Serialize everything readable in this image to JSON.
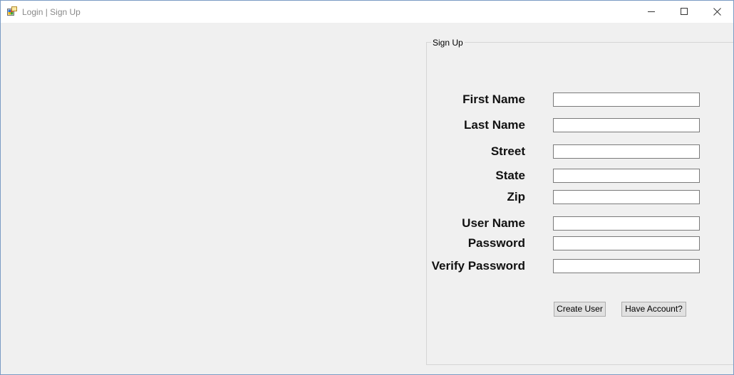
{
  "window": {
    "title": "Login | Sign Up",
    "app_icon": "winforms-app-icon",
    "controls": {
      "minimize_icon": "minimize-icon",
      "maximize_icon": "maximize-icon",
      "close_icon": "close-icon"
    }
  },
  "signup": {
    "group_title": "Sign Up",
    "fields": [
      {
        "label": "First Name",
        "value": "",
        "placeholder": ""
      },
      {
        "label": "Last Name",
        "value": "",
        "placeholder": ""
      },
      {
        "label": "Street",
        "value": "",
        "placeholder": ""
      },
      {
        "label": "State",
        "value": "",
        "placeholder": ""
      },
      {
        "label": "Zip",
        "value": "",
        "placeholder": ""
      },
      {
        "label": "User Name",
        "value": "",
        "placeholder": ""
      },
      {
        "label": "Password",
        "value": "",
        "placeholder": ""
      },
      {
        "label": "Verify Password",
        "value": "",
        "placeholder": ""
      }
    ],
    "buttons": {
      "create_user": "Create User",
      "have_account": "Have Account?"
    }
  },
  "colors": {
    "title_text": "#8a8a8a",
    "window_border": "#7a9bc4",
    "client_background": "#f0f0f0",
    "button_face": "#e1e1e1",
    "input_border": "#7a7a7a"
  }
}
